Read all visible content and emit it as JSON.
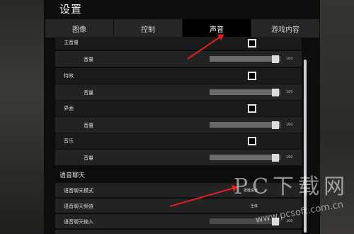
{
  "window": {
    "title": "设置"
  },
  "tabs": [
    {
      "label": "图像",
      "active": false
    },
    {
      "label": "控制",
      "active": false
    },
    {
      "label": "声音",
      "active": true
    },
    {
      "label": "游戏内容",
      "active": false
    }
  ],
  "settings": {
    "master": {
      "label": "主音量",
      "checked": true,
      "volume_label": "音量",
      "volume": 100
    },
    "effects": {
      "label": "特效",
      "checked": true,
      "volume_label": "音量",
      "volume": 100
    },
    "interface": {
      "label": "界面",
      "checked": true,
      "volume_label": "音量",
      "volume": 100
    },
    "music": {
      "label": "音乐",
      "checked": true,
      "volume_label": "音量",
      "volume": 100
    },
    "voice_section": "语音聊天",
    "voice_mode": {
      "label": "语音聊天模式",
      "value": "按键说话"
    },
    "voice_channel": {
      "label": "语音聊天频道",
      "value": "全体"
    },
    "voice_input": {
      "label": "语音聊天输入",
      "value": 100
    }
  },
  "watermark": {
    "line1": "PC下载网",
    "line2": "www.pcsoft.com.cn"
  },
  "colors": {
    "accent_red": "#e02020",
    "panel": "#0d0d0d",
    "active_tab": "#000000"
  }
}
